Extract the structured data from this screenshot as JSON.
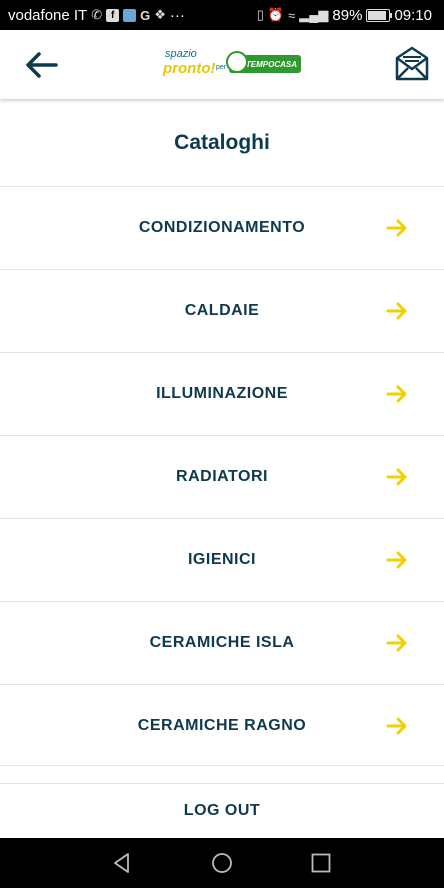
{
  "status_bar": {
    "carrier": "vodafone IT",
    "notification_icons": [
      "whatsapp-icon",
      "flipboard-icon",
      "app-icon",
      "google-icon",
      "twitter-icon"
    ],
    "more": "···",
    "battery": "89%",
    "battery_level": 0.89,
    "time": "09:10"
  },
  "header": {
    "logo_spazio": "spazio",
    "logo_pronto": "pronto!",
    "logo_per": "per",
    "logo_brand": "TEMPOCASA",
    "colors": {
      "accent": "#0f3a4d",
      "arrow": "#f0d000",
      "brand_green": "#2e9a2e"
    }
  },
  "page_title": "Cataloghi",
  "catalog_items": [
    {
      "label": "CONDIZIONAMENTO"
    },
    {
      "label": "CALDAIE"
    },
    {
      "label": "ILLUMINAZIONE"
    },
    {
      "label": "RADIATORI"
    },
    {
      "label": "IGIENICI"
    },
    {
      "label": "CERAMICHE ISLA"
    },
    {
      "label": "CERAMICHE RAGNO"
    }
  ],
  "logout_label": "LOG OUT"
}
